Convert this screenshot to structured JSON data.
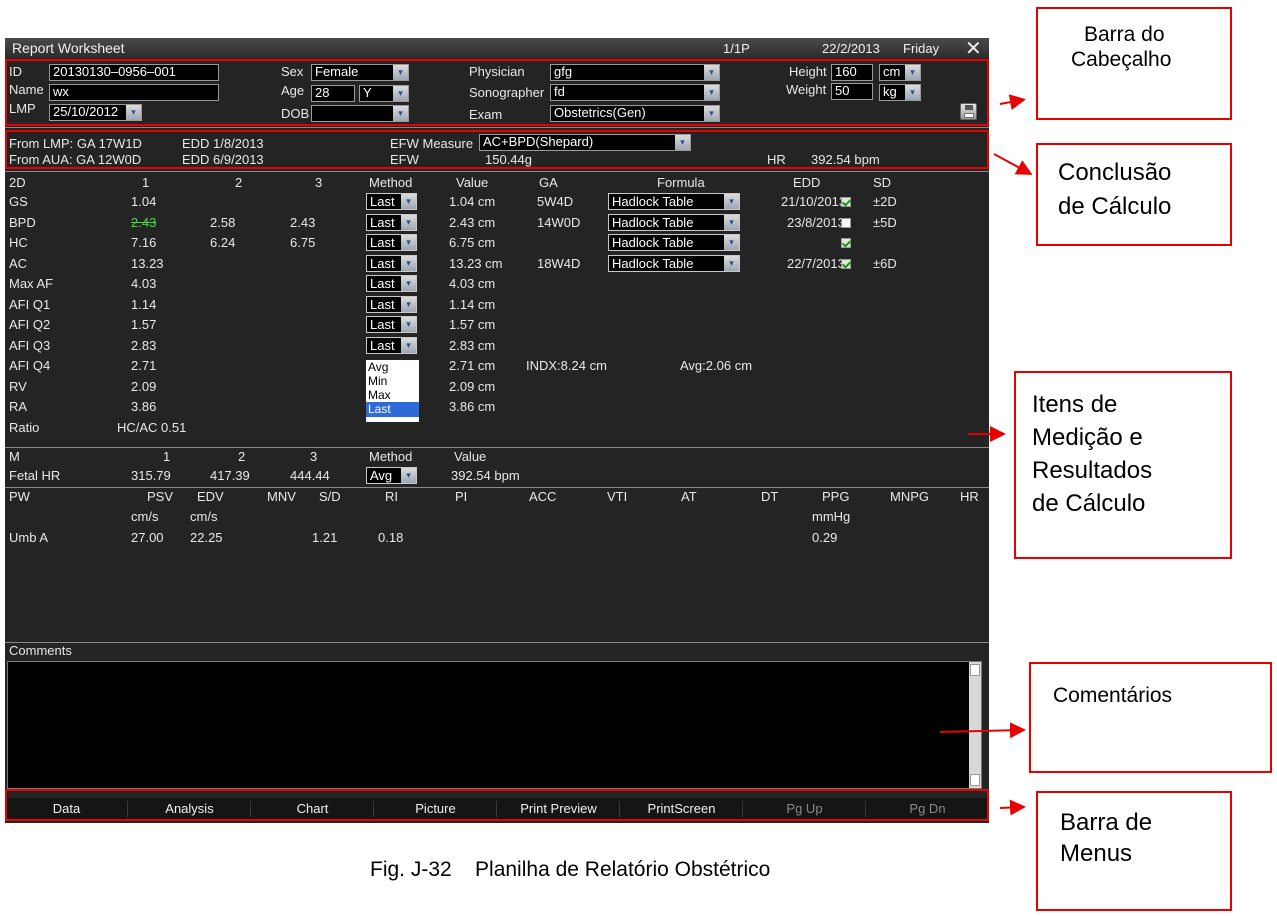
{
  "title_bar": {
    "title": "Report Worksheet",
    "page": "1/1P",
    "date": "22/2/2013",
    "day": "Friday",
    "close_glyph": "✕"
  },
  "patient": {
    "id_label": "ID",
    "id_value": "20130130–0956–001",
    "name_label": "Name",
    "name_value": "wx",
    "lmp_label": "LMP",
    "lmp_value": "25/10/2012",
    "sex_label": "Sex",
    "sex_value": "Female",
    "age_label": "Age",
    "age_value": "28",
    "age_unit": "Y",
    "dob_label": "DOB",
    "dob_value": "",
    "physician_label": "Physician",
    "physician_value": "gfg",
    "sonographer_label": "Sonographer",
    "sonographer_value": "fd",
    "exam_label": "Exam",
    "exam_value": "Obstetrics(Gen)",
    "height_label": "Height",
    "height_value": "160",
    "height_unit": "cm",
    "weight_label": "Weight",
    "weight_value": "50",
    "weight_unit": "kg",
    "save_icon": "floppy-disk-icon"
  },
  "conclusion": {
    "from_lmp": "From LMP:  GA  17W1D",
    "edd_lmp": "EDD 1/8/2013",
    "from_aua": "From AUA:  GA  12W0D",
    "edd_aua": "EDD 6/9/2013",
    "efw_measure_label": "EFW Measure",
    "efw_measure_value": "AC+BPD(Shepard)",
    "efw_label": "EFW",
    "efw_value": "150.44g",
    "hr_label": "HR",
    "hr_value": "392.54 bpm"
  },
  "table_2d": {
    "headers": [
      "2D",
      "1",
      "2",
      "3",
      "Method",
      "Value",
      "GA",
      "Formula",
      "EDD",
      "SD"
    ],
    "rows": [
      {
        "name": "GS",
        "v1": "1.04",
        "v2": "",
        "v3": "",
        "method": "Last",
        "value": "1.04 cm",
        "ga": "5W4D",
        "formula": "Hadlock Table",
        "edd": "21/10/2013",
        "edd_check": true,
        "sd": "±2D"
      },
      {
        "name": "BPD",
        "v1": "2.43",
        "v2": "2.58",
        "v3": "2.43",
        "method": "Last",
        "value": "2.43 cm",
        "ga": "14W0D",
        "formula": "Hadlock Table",
        "edd": "23/8/2013",
        "edd_check": false,
        "sd": "±5D"
      },
      {
        "name": "HC",
        "v1": "7.16",
        "v2": "6.24",
        "v3": "6.75",
        "method": "Last",
        "value": "6.75 cm",
        "ga": "",
        "formula": "Hadlock Table",
        "edd": "",
        "edd_check": true,
        "sd": ""
      },
      {
        "name": "AC",
        "v1": "13.23",
        "v2": "",
        "v3": "",
        "method": "Last",
        "value": "13.23 cm",
        "ga": "18W4D",
        "formula": "Hadlock Table",
        "edd": "22/7/2013",
        "edd_check": true,
        "sd": "±6D"
      },
      {
        "name": "Max AF",
        "v1": "4.03",
        "v2": "",
        "v3": "",
        "method": "Last",
        "value": "4.03 cm"
      },
      {
        "name": "AFI Q1",
        "v1": "1.14",
        "v2": "",
        "v3": "",
        "method": "Last",
        "value": "1.14 cm"
      },
      {
        "name": "AFI Q2",
        "v1": "1.57",
        "v2": "",
        "v3": "",
        "method": "Last",
        "value": "1.57 cm"
      },
      {
        "name": "AFI Q3",
        "v1": "2.83",
        "v2": "",
        "v3": "",
        "method": "Last",
        "value": "2.83 cm"
      },
      {
        "name": "AFI Q4",
        "v1": "2.71",
        "v2": "",
        "v3": "",
        "value": "2.71 cm",
        "extra1": "INDX:8.24 cm",
        "extra2": "Avg:2.06 cm"
      },
      {
        "name": "RV",
        "v1": "2.09",
        "value": "2.09 cm"
      },
      {
        "name": "RA",
        "v1": "3.86",
        "value": "3.86 cm"
      },
      {
        "name": "Ratio",
        "v1": "HC/AC 0.51"
      }
    ],
    "method_options": [
      "Avg",
      "Min",
      "Max",
      "Last"
    ]
  },
  "table_m": {
    "headers": [
      "M",
      "1",
      "2",
      "3",
      "Method",
      "Value"
    ],
    "row": {
      "name": "Fetal HR",
      "v1": "315.79",
      "v2": "417.39",
      "v3": "444.44",
      "method": "Avg",
      "value": "392.54 bpm"
    }
  },
  "table_pw": {
    "headers": [
      "PW",
      "PSV",
      "EDV",
      "MNV",
      "S/D",
      "RI",
      "PI",
      "ACC",
      "VTI",
      "AT",
      "DT",
      "PPG",
      "MNPG",
      "HR"
    ],
    "units": {
      "psv": "cm/s",
      "edv": "cm/s",
      "ppg": "mmHg"
    },
    "row": {
      "name": "Umb A",
      "psv": "27.00",
      "edv": "22.25",
      "sd": "1.21",
      "ri": "0.18",
      "ppg": "0.29"
    }
  },
  "comments": {
    "label": "Comments",
    "text": ""
  },
  "menu": [
    "Data",
    "Analysis",
    "Chart",
    "Picture",
    "Print Preview",
    "PrintScreen",
    "Pg Up",
    "Pg Dn"
  ],
  "annotations": {
    "header": [
      "Barra do",
      "Cabeçalho"
    ],
    "conclusion": [
      "Conclusão",
      "de Cálculo"
    ],
    "items": [
      "Itens de",
      "Medição e",
      "Resultados",
      "de Cálculo"
    ],
    "comments": [
      "Comentários"
    ],
    "menu": [
      "Barra de",
      "Menus"
    ]
  },
  "caption": "Fig. J-32    Planilha de Relatório Obstétrico",
  "colors": {
    "screen_bg": "#242424",
    "annotation_red": "#e60000",
    "highlight_blue": "#2f6bd8"
  }
}
